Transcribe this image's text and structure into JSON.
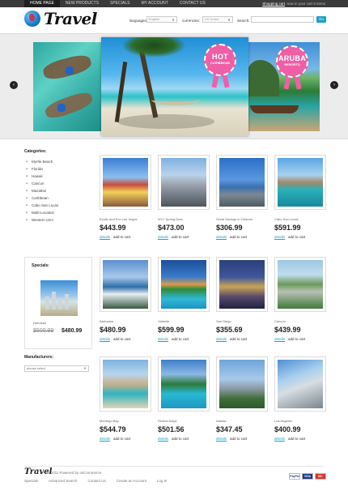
{
  "topnav": {
    "items": [
      "HOME PAGE",
      "NEW PRODUCTS",
      "SPECIALS",
      "MY ACCOUNT",
      "CONTACT US"
    ],
    "cart_link": "Shopping cart",
    "cart_text": ": now in your cart 0 items"
  },
  "header": {
    "logo": "Travel",
    "languages_label": "languages:",
    "languages_value": "English",
    "currencies_label": "currencies:",
    "currencies_value": "US Dollar",
    "search_label": "Search:",
    "search_button": "Go"
  },
  "slider": {
    "badge_hot_big": "HOT",
    "badge_hot_small": "CARIBBEAN",
    "badge_aruba_big": "ARUBA",
    "badge_aruba_small": "RESORTS",
    "prev": "‹",
    "next": "›"
  },
  "sidebar": {
    "categories_title": "Categories:",
    "categories": [
      "Myrtle Beach",
      "Florida",
      "Hawaii",
      "Cancun",
      "Mazatlan",
      "Caribbean",
      "Cabo San Lucas",
      "Multi-Location",
      "Western USA"
    ],
    "specials_title": "Specials:",
    "special_name": "Honolulu",
    "special_old_price": "$500.99",
    "special_new_price": "$480.99",
    "manufacturers_title": "Manufacturers:",
    "manufacturers_value": "please select"
  },
  "products": [
    {
      "name": "Exotic and Fun Las Vegas",
      "price": "$443.99",
      "details": "details",
      "add": "add to cart"
    },
    {
      "name": "NYC Spring Deal",
      "price": "$473.00",
      "details": "details",
      "add": "add to cart"
    },
    {
      "name": "Great Savings in Orlando",
      "price": "$306.99",
      "details": "details",
      "add": "add to cart"
    },
    {
      "name": "Cabo San Lucas",
      "price": "$591.99",
      "details": "details",
      "add": "add to cart"
    },
    {
      "name": "Barbados",
      "price": "$480.99",
      "details": "details",
      "add": "add to cart"
    },
    {
      "name": "Viabelle",
      "price": "$599.99",
      "details": "details",
      "add": "add to cart"
    },
    {
      "name": "San Diego",
      "price": "$355.69",
      "details": "details",
      "add": "add to cart"
    },
    {
      "name": "Cancun",
      "price": "$439.99",
      "details": "details",
      "add": "add to cart"
    },
    {
      "name": "Montego Bay",
      "price": "$544.79",
      "details": "details",
      "add": "add to cart"
    },
    {
      "name": "Riviera Maya",
      "price": "$501.56",
      "details": "details",
      "add": "add to cart"
    },
    {
      "name": "Atlanta",
      "price": "$347.45",
      "details": "details",
      "add": "add to cart"
    },
    {
      "name": "Los Angeles",
      "price": "$400.99",
      "details": "details",
      "add": "add to cart"
    }
  ],
  "footer": {
    "logo": "Travel",
    "copyright": "© 2011 Powered by osCommerce",
    "links": [
      "Specials",
      "Advanced Search",
      "Contact Us",
      "Create an Account",
      "Log In"
    ],
    "payments": [
      "PayPal",
      "VISA",
      "MC"
    ]
  },
  "colors": {
    "accent": "#1aa3c9",
    "nav_bg": "#3a3a3a",
    "badge": "#ef5fa6"
  }
}
